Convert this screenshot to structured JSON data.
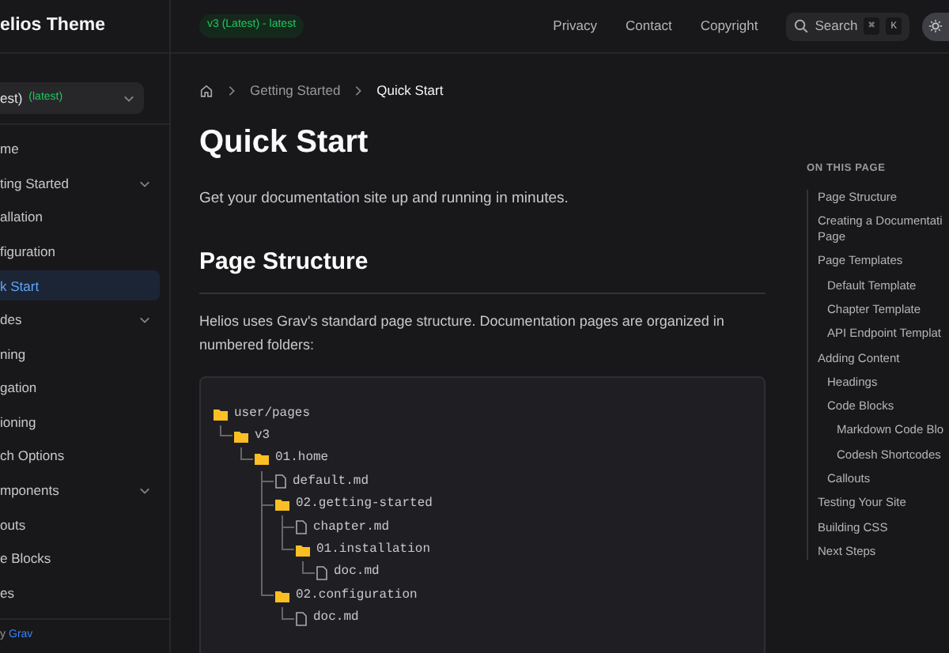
{
  "header": {
    "logo_text": "elios Theme",
    "version_badge": "v3 (Latest) - latest",
    "links": [
      {
        "label": "Privacy"
      },
      {
        "label": "Contact"
      },
      {
        "label": "Copyright"
      }
    ],
    "search": {
      "label": "Search",
      "keys": [
        "⌘",
        "K"
      ]
    }
  },
  "sidebar": {
    "version_select": {
      "value": "est)",
      "tag": "(latest)"
    },
    "items": [
      {
        "label": "me",
        "expandable": false,
        "selected": false
      },
      {
        "label": "ting Started",
        "expandable": true,
        "selected": false
      },
      {
        "label": "allation",
        "expandable": false,
        "selected": false
      },
      {
        "label": "figuration",
        "expandable": false,
        "selected": false
      },
      {
        "label": "k Start",
        "expandable": false,
        "selected": true
      },
      {
        "label": "des",
        "expandable": true,
        "selected": false
      },
      {
        "label": "ning",
        "expandable": false,
        "selected": false
      },
      {
        "label": "gation",
        "expandable": false,
        "selected": false
      },
      {
        "label": "ioning",
        "expandable": false,
        "selected": false
      },
      {
        "label": "ch Options",
        "expandable": false,
        "selected": false
      },
      {
        "label": "mponents",
        "expandable": true,
        "selected": false
      },
      {
        "label": "outs",
        "expandable": false,
        "selected": false
      },
      {
        "label": "e Blocks",
        "expandable": false,
        "selected": false
      },
      {
        "label": "es",
        "expandable": false,
        "selected": false
      }
    ],
    "footer": {
      "text": "y",
      "link": "Grav"
    }
  },
  "breadcrumb": [
    {
      "label": "Getting Started"
    },
    {
      "label": "Quick Start"
    }
  ],
  "title": "Quick Start",
  "lead": "Get your documentation site up and running in minutes.",
  "section": {
    "heading": "Page Structure",
    "text": "Helios uses Grav's standard page structure. Documentation pages are organized in numbered folders:",
    "tree": [
      {
        "name": "user/pages",
        "kind": "folder",
        "children": [
          {
            "name": "v3",
            "kind": "folder",
            "children": [
              {
                "name": "01.home",
                "kind": "folder",
                "children": [
                  {
                    "name": "default.md",
                    "kind": "file"
                  },
                  {
                    "name": "02.getting-started",
                    "kind": "folder",
                    "children": [
                      {
                        "name": "chapter.md",
                        "kind": "file"
                      },
                      {
                        "name": "01.installation",
                        "kind": "folder",
                        "children": [
                          {
                            "name": "doc.md",
                            "kind": "file"
                          }
                        ]
                      }
                    ]
                  },
                  {
                    "name": "02.configuration",
                    "kind": "folder",
                    "children": [
                      {
                        "name": "doc.md",
                        "kind": "file"
                      }
                    ]
                  }
                ]
              }
            ]
          }
        ]
      }
    ]
  },
  "toc": {
    "title": "ON THIS PAGE",
    "items": [
      {
        "label": "Page Structure"
      },
      {
        "label": "Creating a Documentati\nPage"
      },
      {
        "label": "Page Templates",
        "children": [
          {
            "label": "Default Template"
          },
          {
            "label": "Chapter Template"
          },
          {
            "label": "API Endpoint Templat"
          }
        ]
      },
      {
        "label": "Adding Content",
        "children": [
          {
            "label": "Headings"
          },
          {
            "label": "Code Blocks",
            "children": [
              {
                "label": "Markdown Code Blo"
              },
              {
                "label": "Codesh Shortcodes"
              }
            ]
          },
          {
            "label": "Callouts"
          }
        ]
      },
      {
        "label": "Testing Your Site"
      },
      {
        "label": "Building CSS"
      },
      {
        "label": "Next Steps"
      }
    ]
  }
}
